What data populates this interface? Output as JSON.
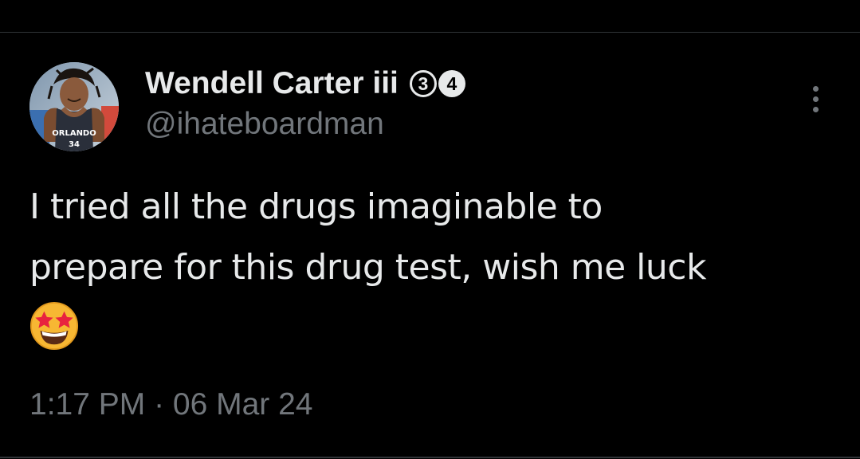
{
  "tweet": {
    "author": {
      "display_name": "Wendell Carter iii",
      "badges": [
        "3",
        "4"
      ],
      "handle": "@ihateboardman",
      "avatar_jersey_text": "ORLANDO",
      "avatar_jersey_number": "34"
    },
    "menu_icon": "more-vertical-icon",
    "text": "I tried all the drugs imaginable to\nprepare for this drug test, wish me luck",
    "emoji": "star-struck-emoji",
    "timestamp": "1:17 PM · 06 Mar 24"
  },
  "colors": {
    "background": "#000000",
    "primary_text": "#e7e9ea",
    "secondary_text": "#71767b",
    "divider": "#2f3336"
  }
}
